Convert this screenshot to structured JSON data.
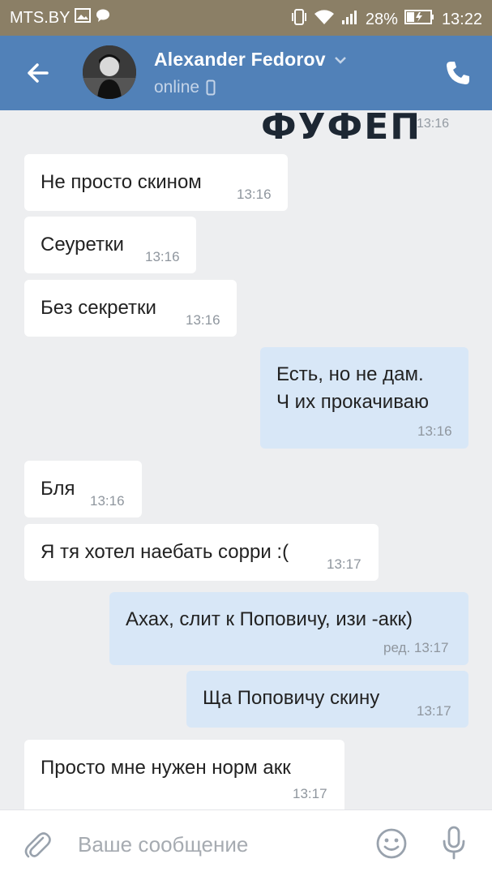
{
  "status_bar": {
    "carrier": "MTS.BY",
    "battery": "28%",
    "time": "13:22"
  },
  "header": {
    "contact_name": "Alexander Fedorov",
    "presence": "online"
  },
  "sticker": {
    "text": "ФУФЕП",
    "time": "13:16"
  },
  "messages": [
    {
      "dir": "in",
      "text": "Не просто скином",
      "time": "13:16"
    },
    {
      "dir": "in",
      "text": "Сеуретки",
      "time": "13:16"
    },
    {
      "dir": "in",
      "text": "Без секретки",
      "time": "13:16"
    },
    {
      "dir": "out",
      "lines": [
        "Есть, но не дам.",
        "Ч их прокачиваю"
      ],
      "time": "13:16"
    },
    {
      "dir": "in",
      "text": "Бля",
      "time": "13:16"
    },
    {
      "dir": "in",
      "text": "Я тя хотел наебать сорри :(",
      "time": "13:17"
    },
    {
      "dir": "out",
      "text": "Ахах, слит к Поповичу, изи -акк)",
      "time": "ред. 13:17"
    },
    {
      "dir": "out",
      "text": "Ща Поповичу скину",
      "time": "13:17"
    },
    {
      "dir": "in",
      "text": "Просто мне нужен норм акк",
      "time": "13:17"
    }
  ],
  "composer": {
    "placeholder": "Ваше сообщение",
    "value": ""
  },
  "colors": {
    "header_bg": "#5181b8",
    "status_bg": "#8b7f66",
    "chat_bg": "#edeef0",
    "incoming_bubble": "#ffffff",
    "outgoing_bubble": "#d8e7f7"
  },
  "icons": [
    "back-arrow-icon",
    "chevron-down-icon",
    "mobile-device-icon",
    "phone-icon",
    "paperclip-icon",
    "smiley-icon",
    "microphone-icon"
  ]
}
